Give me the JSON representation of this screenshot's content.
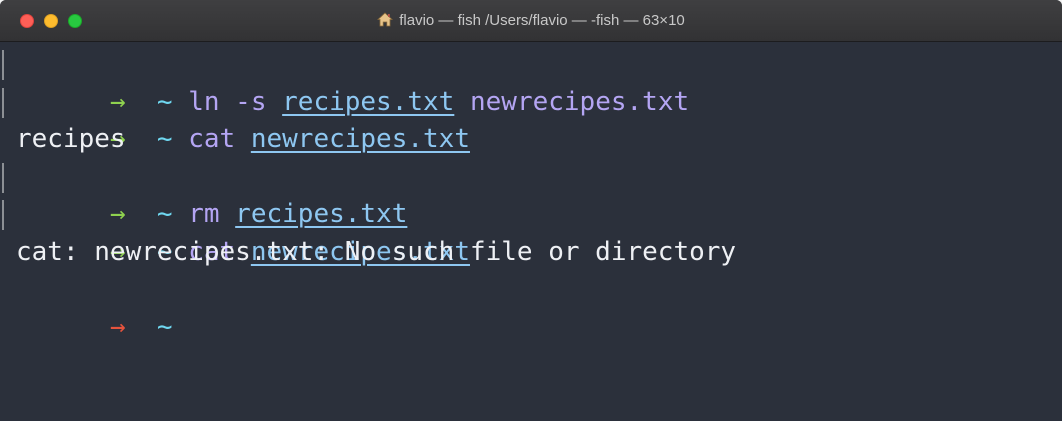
{
  "window": {
    "title": "flavio — fish /Users/flavio — -fish — 63×10",
    "title_icon": "home-icon"
  },
  "colors": {
    "background": "#2b303b",
    "prompt_ok": "#8fd14f",
    "prompt_fail": "#e5533d",
    "tilde": "#6fd7f0",
    "command": "#b4a5f3",
    "file": "#8ec7f1",
    "output": "#eef0f4"
  },
  "terminal": {
    "lines": [
      {
        "arrow": "→",
        "tilde": "~",
        "cmd": "ln",
        "arg": "-s",
        "file1": "recipes.txt",
        "plain": "newrecipes.txt"
      },
      {
        "arrow": "→",
        "tilde": "~",
        "cmd": "cat",
        "file1": "newrecipes.txt"
      },
      {
        "output": "recipes"
      },
      {
        "arrow": "→",
        "tilde": "~",
        "cmd": "rm",
        "file1": "recipes.txt"
      },
      {
        "arrow": "→",
        "tilde": "~",
        "cmd": "cat",
        "file1": "newrecipes.txt"
      },
      {
        "output": "cat: newrecipes.txt: No such file or directory"
      },
      {
        "arrow": "→",
        "tilde": "~"
      }
    ]
  }
}
